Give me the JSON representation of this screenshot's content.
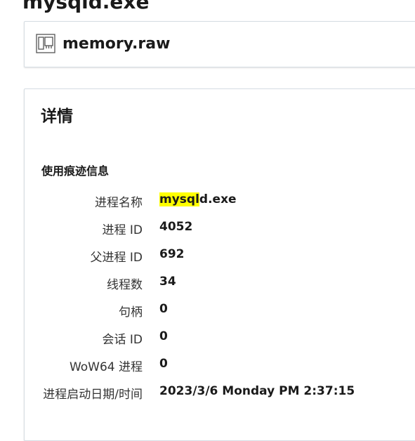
{
  "page": {
    "title": "mysqld.exe"
  },
  "file": {
    "name": "memory.raw",
    "icon": "memory-dump-icon"
  },
  "details": {
    "title": "详情",
    "section_title": "使用痕迹信息",
    "rows": [
      {
        "label": "进程名称",
        "value_highlight": "mysql",
        "value_rest": "d.exe"
      },
      {
        "label": "进程 ID",
        "value": "4052"
      },
      {
        "label": "父进程 ID",
        "value": "692"
      },
      {
        "label": "线程数",
        "value": "34"
      },
      {
        "label": "句柄",
        "value": "0"
      },
      {
        "label": "会话 ID",
        "value": "0"
      },
      {
        "label": "WoW64 进程",
        "value": "0"
      },
      {
        "label": "进程启动日期/时间",
        "value": "2023/3/6 Monday PM 2:37:15"
      }
    ]
  },
  "colors": {
    "highlight": "#ffff00",
    "card_border": "#d6dde3"
  }
}
